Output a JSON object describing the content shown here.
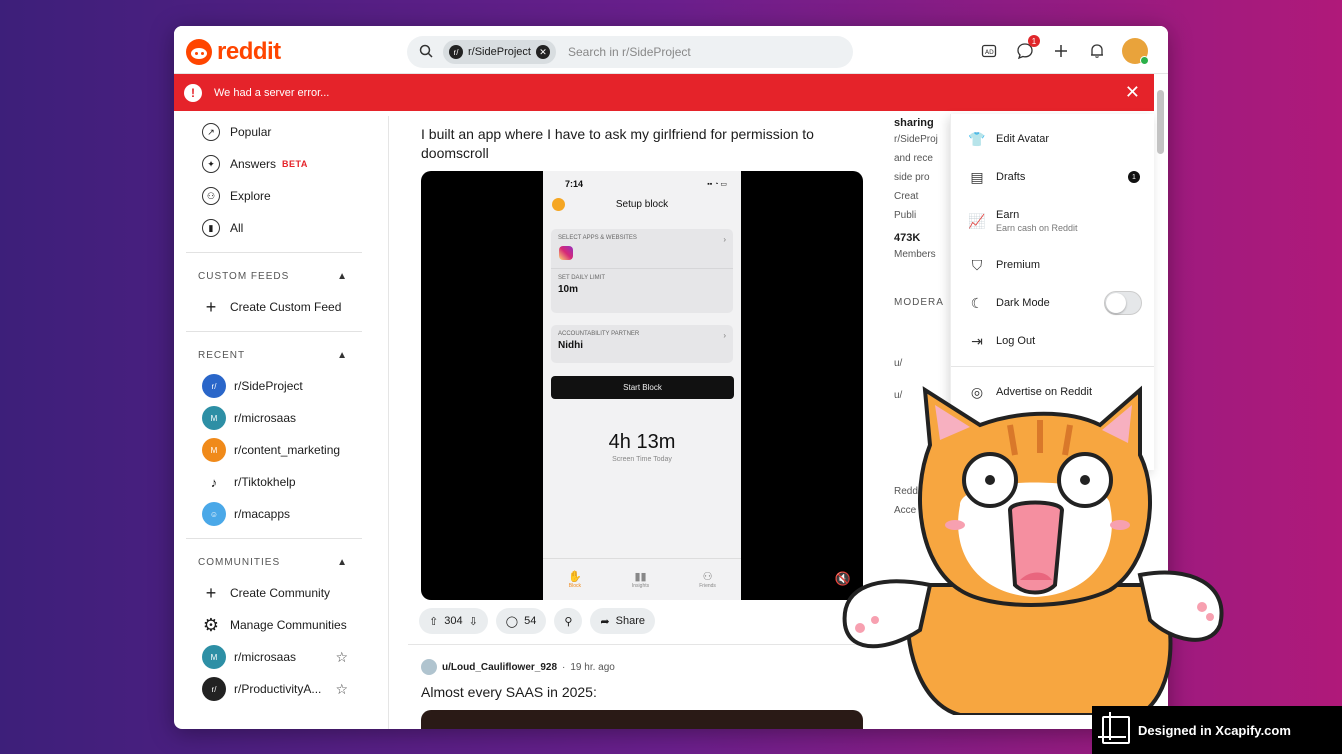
{
  "header": {
    "logo_text": "reddit",
    "search_chip": "r/SideProject",
    "search_placeholder": "Search in r/SideProject",
    "chat_badge": "1"
  },
  "error_banner": {
    "text": "We had a server error..."
  },
  "sidebar": {
    "nav": [
      {
        "label": "Popular"
      },
      {
        "label": "Answers",
        "badge": "BETA"
      },
      {
        "label": "Explore"
      },
      {
        "label": "All"
      }
    ],
    "custom_feeds": {
      "heading": "CUSTOM FEEDS",
      "create": "Create Custom Feed"
    },
    "recent": {
      "heading": "RECENT",
      "items": [
        "r/SideProject",
        "r/microsaas",
        "r/content_marketing",
        "r/Tiktokhelp",
        "r/macapps"
      ]
    },
    "communities": {
      "heading": "COMMUNITIES",
      "create": "Create Community",
      "manage": "Manage Communities",
      "items": [
        "r/microsaas",
        "r/ProductivityA..."
      ]
    }
  },
  "post1": {
    "title": "I built an app where I have to ask my girlfriend for permission to doomscroll",
    "upvotes": "304",
    "comments": "54",
    "share": "Share",
    "phone": {
      "time": "7:14",
      "title": "Setup block",
      "select_label": "SELECT APPS & WEBSITES",
      "limit_label": "SET DAILY LIMIT",
      "limit_value": "10m",
      "partner_label": "ACCOUNTABILITY PARTNER",
      "partner_value": "Nidhi",
      "button": "Start Block",
      "big": "4h 13m",
      "small": "Screen Time Today",
      "tabs": [
        "Block",
        "Insights",
        "Friends"
      ]
    }
  },
  "post2": {
    "author": "u/Loud_Cauliflower_928",
    "time": "19 hr. ago",
    "title": "Almost every SAAS in 2025:"
  },
  "right_column": {
    "title": "sharing",
    "line1": "r/SideProj",
    "line2": "and rece",
    "line3": "side pro",
    "created": "Creat",
    "public": "Publi",
    "members_count": "473K",
    "members_label": "Members",
    "mods_heading": "MODERA",
    "mod1": "u/",
    "mod2": "u/",
    "footer1": "Redd",
    "footer2": "Acce"
  },
  "menu": {
    "items": [
      {
        "label": "Edit Avatar"
      },
      {
        "label": "Drafts",
        "badge": "1"
      },
      {
        "label": "Earn",
        "sub": "Earn cash on Reddit"
      },
      {
        "label": "Premium"
      },
      {
        "label": "Dark Mode"
      },
      {
        "label": "Log Out"
      },
      {
        "label": "Advertise on Reddit"
      }
    ]
  },
  "watermark": {
    "text": "Designed in Xcapify.com"
  },
  "colors": {
    "brand": "#ff4500",
    "error": "#e5232a"
  }
}
